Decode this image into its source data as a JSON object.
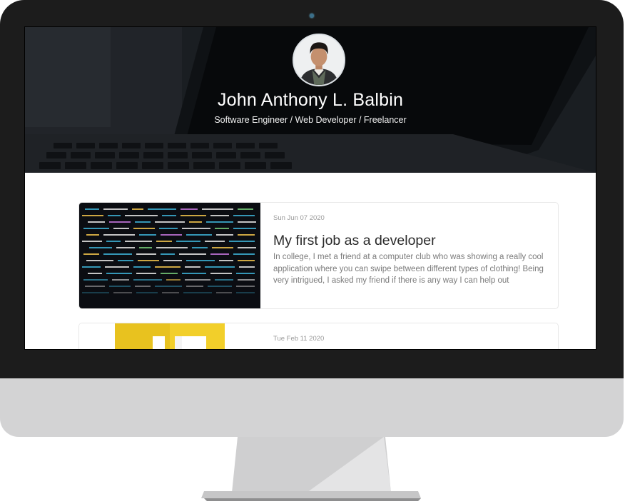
{
  "profile": {
    "name": "John Anthony L. Balbin",
    "subtitle": "Software Engineer / Web Developer / Freelancer"
  },
  "posts": [
    {
      "date": "Sun Jun 07 2020",
      "title": "My first job as a developer",
      "excerpt": "In college, I met a friend at a computer club who was showing a really cool application where you can swipe between different types of clothing! Being very intrigued, I asked my friend if there is any way I can help out"
    },
    {
      "date": "Tue Feb 11 2020"
    }
  ]
}
